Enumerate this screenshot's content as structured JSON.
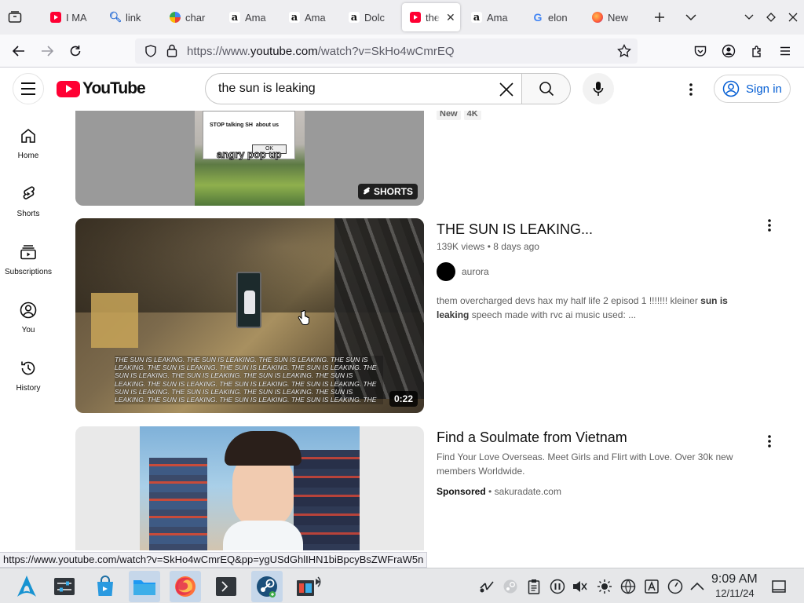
{
  "browser": {
    "tabs": [
      {
        "title": "I MA",
        "icon": "youtube-favicon"
      },
      {
        "title": "link",
        "icon": "search-favicon"
      },
      {
        "title": "char",
        "icon": "chart-favicon"
      },
      {
        "title": "Ama",
        "icon": "amazon-favicon"
      },
      {
        "title": "Ama",
        "icon": "amazon-favicon"
      },
      {
        "title": "Dolc",
        "icon": "amazon-favicon"
      },
      {
        "title": "the",
        "icon": "youtube-favicon",
        "active": true
      },
      {
        "title": "Ama",
        "icon": "amazon-favicon"
      },
      {
        "title": "elon",
        "icon": "google-favicon"
      },
      {
        "title": "New",
        "icon": "firefox-favicon"
      }
    ],
    "url_prefix": "https://www.",
    "url_domain": "youtube.com",
    "url_suffix": "/watch?v=SkHo4wCmrEQ",
    "status_url": "https://www.youtube.com/watch?v=SkHo4wCmrEQ&pp=ygUSdGhlIHN1biBpcyBsZWFraW5n"
  },
  "youtube": {
    "logo_text": "YouTube",
    "search_query": "the sun is leaking",
    "sign_in_label": "Sign in",
    "guide": [
      {
        "label": "Home",
        "icon": "home-icon"
      },
      {
        "label": "Shorts",
        "icon": "shorts-icon"
      },
      {
        "label": "Subscriptions",
        "icon": "subscriptions-icon"
      },
      {
        "label": "You",
        "icon": "you-icon"
      },
      {
        "label": "History",
        "icon": "history-icon"
      }
    ],
    "results": {
      "top_chips": [
        "New",
        "4K"
      ],
      "shorts_badge": "SHORTS",
      "shorts_overlay_text": "angry pop up",
      "popup_text": "STOP talking SH  about us",
      "popup_ok": "OK",
      "video": {
        "title": "THE SUN IS LEAKING...",
        "views": "139K views",
        "age": "8 days ago",
        "channel": "aurora",
        "description_before": "them overcharged devs hax my half life 2 episod 1 !!!!!!! kleiner ",
        "description_bold": "sun is leaking",
        "description_after": " speech made with rvc ai music used: ...",
        "duration": "0:22",
        "thumb_caption": "THE SUN IS LEAKING. THE SUN IS LEAKING. THE SUN IS LEAKING. THE SUN IS LEAKING. THE SUN IS LEAKING. THE SUN IS LEAKING. THE SUN IS LEAKING. THE SUN IS LEAKING. THE SUN IS LEAKING. THE SUN IS LEAKING. THE SUN IS LEAKING. THE SUN IS LEAKING. THE SUN IS LEAKING. THE SUN IS LEAKING. THE SUN IS LEAKING. THE SUN IS LEAKING. THE SUN IS LEAKING. THE SUN IS LEAKING. THE SUN IS LEAKING. THE SUN IS LEAKING. THE SUN IS LEAKING. THE SUN IS LEAKING. THE SUN IS LEAKING. THE SUN IS LEAKING. THE SUN IS LEAKING."
      },
      "ad": {
        "title": "Find a Soulmate from Vietnam",
        "description": "Find Your Love Overseas. Meet Girls and Flirt with Love. Over 30k new members Worldwide.",
        "sponsored_label": "Sponsored",
        "domain": "sakuradate.com"
      }
    }
  },
  "taskbar": {
    "clock_time": "9:09 AM",
    "clock_date": "12/11/24"
  },
  "colors": {
    "yt_red": "#ff0033",
    "link_blue": "#065fd4",
    "taskbar_bg": "#e6e7e9"
  }
}
